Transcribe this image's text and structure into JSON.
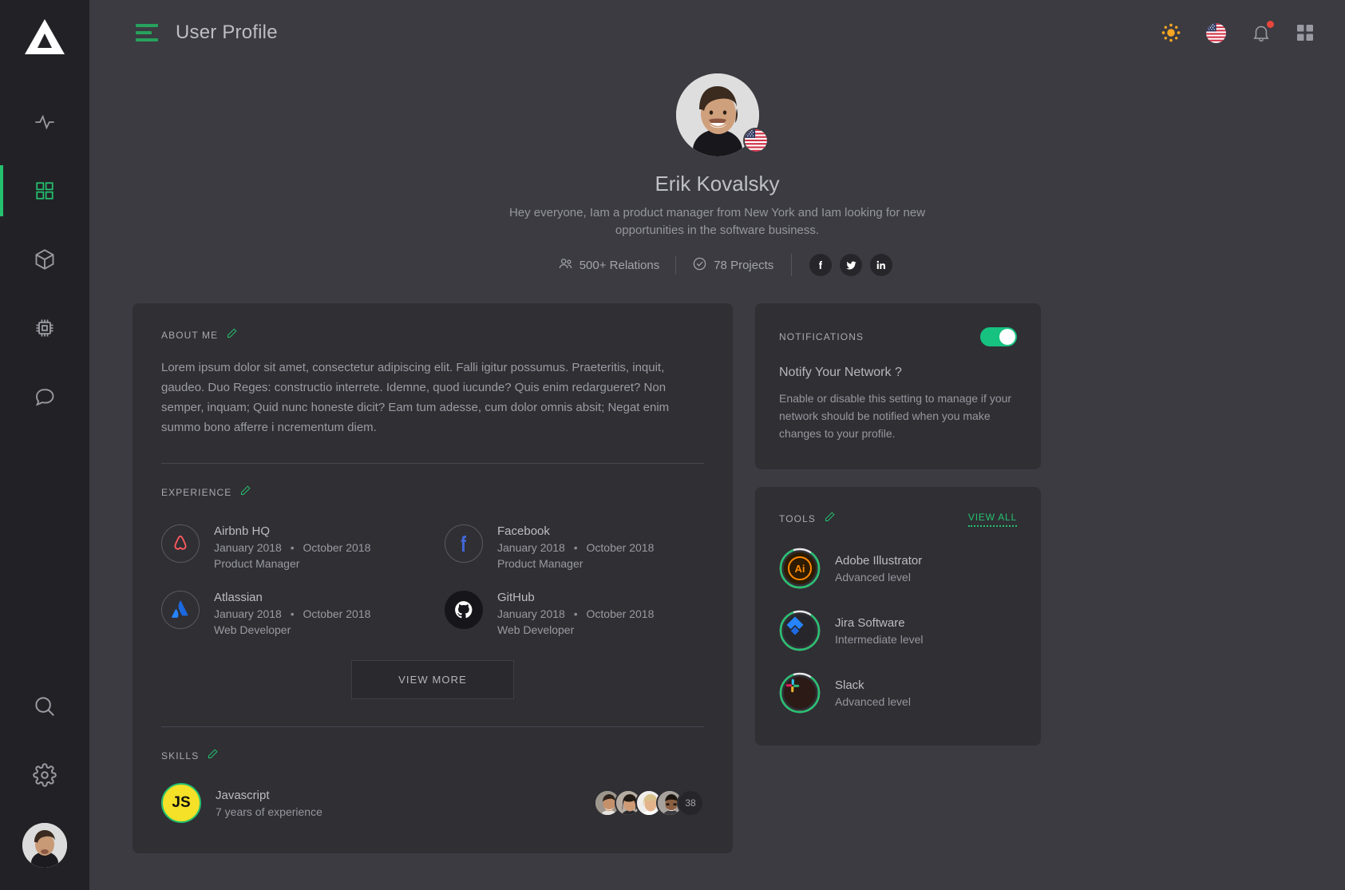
{
  "sidebar": {
    "logo_name": "triangle-logo",
    "items": [
      {
        "icon": "activity-icon",
        "name": "activity",
        "active": false
      },
      {
        "icon": "grid-icon",
        "name": "dashboard",
        "active": true
      },
      {
        "icon": "cube-icon",
        "name": "packages",
        "active": false
      },
      {
        "icon": "chip-icon",
        "name": "hardware",
        "active": false
      },
      {
        "icon": "chat-icon",
        "name": "messages",
        "active": false
      }
    ],
    "bottom": [
      {
        "icon": "search-icon",
        "name": "search"
      },
      {
        "icon": "gear-icon",
        "name": "settings"
      },
      {
        "icon": "avatar",
        "name": "user-avatar"
      }
    ]
  },
  "topbar": {
    "menu_icon": "hamburger-icon",
    "title": "User Profile",
    "actions": [
      {
        "icon": "sun-icon",
        "name": "theme-toggle"
      },
      {
        "icon": "us-flag-icon",
        "name": "language-selector"
      },
      {
        "icon": "bell-icon",
        "name": "notifications",
        "badge": true
      },
      {
        "icon": "apps-grid-icon",
        "name": "apps-menu"
      }
    ]
  },
  "profile": {
    "avatar_name": "profile-avatar",
    "country_flag": "us-flag",
    "name": "Erik Kovalsky",
    "bio": "Hey everyone,  Iam a product manager from New York and Iam looking for new opportunities in the software business.",
    "stats": [
      {
        "icon": "people-icon",
        "label": "500+ Relations"
      },
      {
        "icon": "check-circle-icon",
        "label": "78 Projects"
      }
    ],
    "socials": [
      {
        "icon": "facebook-icon",
        "name": "facebook"
      },
      {
        "icon": "twitter-icon",
        "name": "twitter"
      },
      {
        "icon": "linkedin-icon",
        "name": "linkedin"
      }
    ]
  },
  "about": {
    "title": "ABOUT ME",
    "edit_icon": "pencil-icon",
    "text": "Lorem ipsum dolor sit amet, consectetur adipiscing elit. Falli igitur possumus. Praeteritis, inquit, gaudeo. Duo Reges: constructio interrete. Idemne, quod iucunde? Quis enim redargueret? Non semper, inquam; Quid nunc honeste dicit? Eam tum adesse, cum dolor omnis absit; Negat enim summo bono afferre i ncrementum diem."
  },
  "experience": {
    "title": "EXPERIENCE",
    "edit_icon": "pencil-icon",
    "items": [
      {
        "company": "Airbnb HQ",
        "start": "January 2018",
        "end": "October 2018",
        "role": "Product Manager",
        "logo": "airbnb-icon"
      },
      {
        "company": "Facebook",
        "start": "January 2018",
        "end": "October 2018",
        "role": "Product Manager",
        "logo": "facebook-icon"
      },
      {
        "company": "Atlassian",
        "start": "January 2018",
        "end": "October 2018",
        "role": "Web Developer",
        "logo": "atlassian-icon"
      },
      {
        "company": "GitHub",
        "start": "January 2018",
        "end": "October 2018",
        "role": "Web Developer",
        "logo": "github-icon"
      }
    ],
    "view_more_label": "VIEW MORE"
  },
  "skills": {
    "title": "SKILLS",
    "edit_icon": "pencil-icon",
    "items": [
      {
        "badge": "JS",
        "name": "Javascript",
        "experience": "7 years of experience",
        "people_count": "38",
        "people_avatars": [
          "avatar-1",
          "avatar-2",
          "avatar-3",
          "avatar-4"
        ]
      }
    ]
  },
  "notifications": {
    "title": "NOTIFICATIONS",
    "enabled": true,
    "question": "Notify Your Network ?",
    "description": "Enable or disable this setting to manage if your network should be notified when you make changes to your profile."
  },
  "tools": {
    "title": "TOOLS",
    "edit_icon": "pencil-icon",
    "view_all_label": "VIEW ALL",
    "items": [
      {
        "name": "Adobe Illustrator",
        "level": "Advanced level",
        "icon": "adobe-illustrator-icon",
        "progress": 85
      },
      {
        "name": "Jira Software",
        "level": "Intermediate level",
        "icon": "jira-icon",
        "progress": 85
      },
      {
        "name": "Slack",
        "level": "Advanced level",
        "icon": "slack-icon",
        "progress": 85
      }
    ]
  },
  "colors": {
    "accent_green": "#25c16f",
    "toggle_green": "#17c281",
    "page_bg": "#3b3b41",
    "card_bg": "#2f2f34",
    "sidebar_bg": "#222226",
    "notification_dot": "#e8453c"
  }
}
